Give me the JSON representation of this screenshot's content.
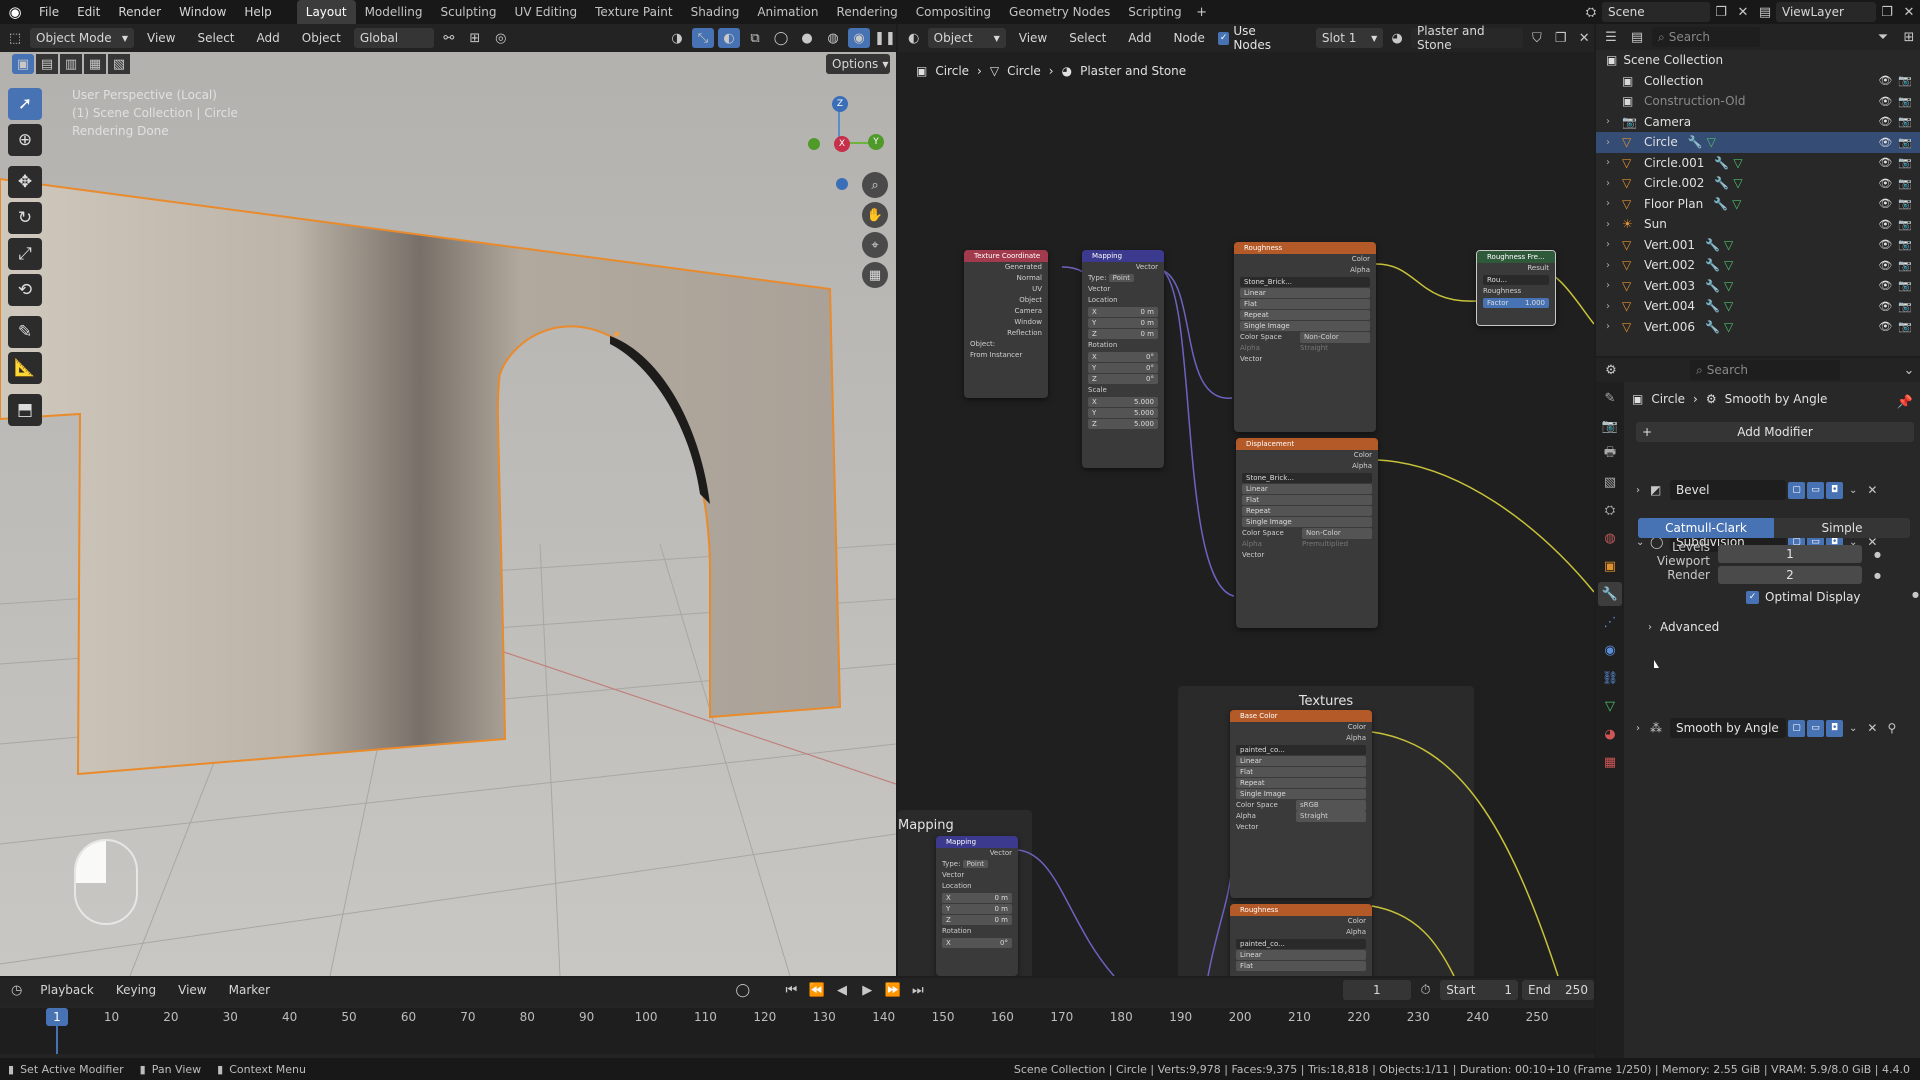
{
  "menus": [
    "File",
    "Edit",
    "Render",
    "Window",
    "Help"
  ],
  "workspaces": [
    "Layout",
    "Modelling",
    "Sculpting",
    "UV Editing",
    "Texture Paint",
    "Shading",
    "Animation",
    "Rendering",
    "Compositing",
    "Geometry Nodes",
    "Scripting"
  ],
  "active_workspace": "Layout",
  "scene": {
    "name": "Scene",
    "view_layer": "ViewLayer"
  },
  "viewport": {
    "mode": "Object Mode",
    "menu": [
      "View",
      "Select",
      "Add",
      "Object"
    ],
    "orientation": "Global",
    "options_label": "Options",
    "info": [
      "User Perspective (Local)",
      "(1) Scene Collection | Circle",
      "Rendering Done"
    ],
    "gizmo_axes": {
      "x": "X",
      "y": "Y",
      "z": "Z"
    }
  },
  "node_editor": {
    "object_label": "Object",
    "menu": [
      "View",
      "Select",
      "Add",
      "Node"
    ],
    "use_nodes": "Use Nodes",
    "slot": "Slot 1",
    "material": "Plaster and Stone",
    "breadcrumb": [
      "Circle",
      "Circle",
      "Plaster and Stone"
    ],
    "frame_label": "Textures",
    "frame2_label": "Mapping",
    "nodes": {
      "texcoord": {
        "title": "Texture Coordinate",
        "outputs": [
          "Generated",
          "Normal",
          "UV",
          "Object",
          "Camera",
          "Window",
          "Reflection"
        ],
        "object_label": "Object:",
        "from_instancer": "From Instancer"
      },
      "mapping": {
        "title": "Mapping",
        "out": "Vector",
        "type_label": "Type:",
        "type": "Point",
        "vector": "Vector",
        "location": "Location",
        "loc": [
          "0 m",
          "0 m",
          "0 m"
        ],
        "rotation": "Rotation",
        "rot": [
          "0°",
          "0°",
          "0°"
        ],
        "scale": "Scale",
        "scl": [
          "5.000",
          "5.000",
          "5.000"
        ],
        "axes": [
          "X",
          "Y",
          "Z"
        ]
      },
      "roughness": {
        "title": "Roughness",
        "outs": [
          "Color",
          "Alpha"
        ],
        "image": "Stone_Brick...",
        "opts": [
          "Linear",
          "Flat",
          "Repeat",
          "Single Image"
        ],
        "cs_label": "Color Space",
        "cs": "Non-Color",
        "alpha_label": "Alpha",
        "alpha": "Straight",
        "vector": "Vector"
      },
      "displacement": {
        "title": "Displacement",
        "outs": [
          "Color",
          "Alpha"
        ],
        "image": "Stone_Brick...",
        "opts": [
          "Linear",
          "Flat",
          "Repeat",
          "Single Image"
        ],
        "cs_label": "Color Space",
        "cs": "Non-Color",
        "alpha_label": "Alpha",
        "alpha": "Premultiplied",
        "vector": "Vector"
      },
      "roughfre": {
        "title": "Roughness Fre...",
        "result": "Result",
        "img": "Rou...",
        "roughness": "Roughness",
        "factor_label": "Factor",
        "factor": "1.000"
      },
      "basecolor": {
        "title": "Base Color",
        "outs": [
          "Color",
          "Alpha"
        ],
        "image": "painted_co...",
        "opts": [
          "Linear",
          "Flat",
          "Repeat",
          "Single Image"
        ],
        "cs_label": "Color Space",
        "cs": "sRGB",
        "alpha_label": "Alpha",
        "alpha": "Straight",
        "vector": "Vector"
      },
      "roughness2": {
        "title": "Roughness",
        "outs": [
          "Color",
          "Alpha"
        ],
        "image": "painted_co...",
        "opts": [
          "Linear",
          "Flat"
        ]
      },
      "mapping2": {
        "title": "Mapping",
        "out": "Vector",
        "type_label": "Type:",
        "type": "Point",
        "vector": "Vector",
        "location": "Location",
        "loc": [
          "0 m",
          "0 m",
          "0 m"
        ],
        "rotation": "Rotation",
        "rot": [
          "0°"
        ],
        "axes": [
          "X",
          "Y",
          "Z"
        ]
      }
    }
  },
  "outliner": {
    "search_placeholder": "Search",
    "root": "Scene Collection",
    "items": [
      {
        "name": "Collection",
        "indent": 1,
        "icon": "collection"
      },
      {
        "name": "Construction-Old",
        "indent": 1,
        "icon": "collection",
        "dim": true
      },
      {
        "name": "Camera",
        "indent": 1,
        "icon": "camera"
      },
      {
        "name": "Circle",
        "indent": 1,
        "icon": "mesh",
        "selected": true
      },
      {
        "name": "Circle.001",
        "indent": 1,
        "icon": "mesh"
      },
      {
        "name": "Circle.002",
        "indent": 1,
        "icon": "mesh"
      },
      {
        "name": "Floor Plan",
        "indent": 1,
        "icon": "mesh"
      },
      {
        "name": "Sun",
        "indent": 1,
        "icon": "light"
      },
      {
        "name": "Vert.001",
        "indent": 1,
        "icon": "mesh"
      },
      {
        "name": "Vert.002",
        "indent": 1,
        "icon": "mesh"
      },
      {
        "name": "Vert.003",
        "indent": 1,
        "icon": "mesh"
      },
      {
        "name": "Vert.004",
        "indent": 1,
        "icon": "mesh"
      },
      {
        "name": "Vert.006",
        "indent": 1,
        "icon": "mesh"
      }
    ]
  },
  "properties": {
    "search_placeholder": "Search",
    "breadcrumb": [
      "Circle",
      "Smooth by Angle"
    ],
    "add_modifier": "Add Modifier",
    "modifiers": [
      {
        "name": "Bevel",
        "expanded": false
      },
      {
        "name": "Subdivision",
        "expanded": true
      },
      {
        "name": "Smooth by Angle",
        "expanded": false
      }
    ],
    "subdiv": {
      "mode_a": "Catmull-Clark",
      "mode_b": "Simple",
      "levels_label": "Levels Viewport",
      "levels": "1",
      "render_label": "Render",
      "render": "2",
      "optimal": "Optimal Display",
      "advanced": "Advanced"
    }
  },
  "timeline": {
    "menu": [
      "Playback",
      "Keying",
      "View",
      "Marker"
    ],
    "current_frame": "1",
    "start_label": "Start",
    "start": "1",
    "end_label": "End",
    "end": "250",
    "ticks": [
      "1",
      "10",
      "20",
      "30",
      "40",
      "50",
      "60",
      "70",
      "80",
      "90",
      "100",
      "110",
      "120",
      "130",
      "140",
      "150",
      "160",
      "170",
      "180",
      "190",
      "200",
      "210",
      "220",
      "230",
      "240",
      "250"
    ]
  },
  "statusbar": {
    "left": [
      "Set Active Modifier",
      "Pan View",
      "Context Menu"
    ],
    "right": "Scene Collection | Circle | Verts:9,978 | Faces:9,375 | Tris:18,818 | Objects:1/11 | Duration: 00:10+10 (Frame 1/250) | Memory: 2.55 GiB | VRAM: 5.9/8.0 GiB | 4.4.0"
  },
  "colors": {
    "accent": "#4772b3",
    "selection": "#e98a2b",
    "texture_node": "#b45a28",
    "mapping_node": "#3c3a8e",
    "texcoord_node": "#a23a4e",
    "yellow_link": "#c8c23a",
    "purple_link": "#6c63c0"
  }
}
